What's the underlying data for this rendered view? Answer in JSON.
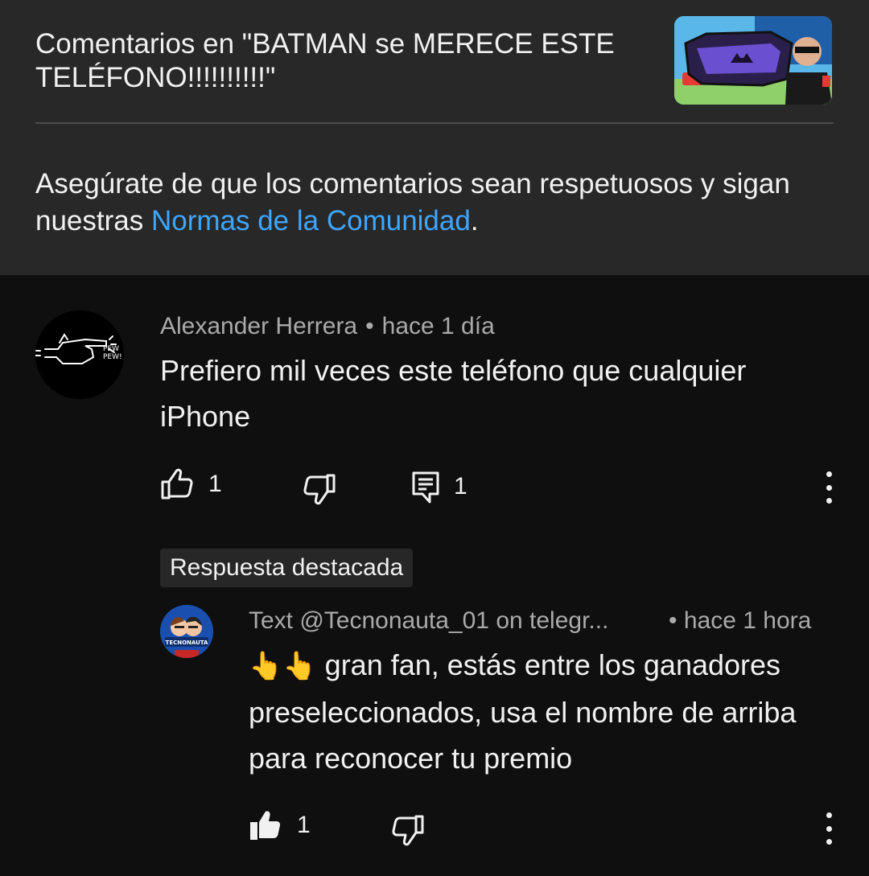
{
  "header": {
    "video_title": "Comentarios en \"BATMAN se MERECE ESTE TELÉFONO!!!!!!!!!!\"",
    "guidelines_text": "Asegúrate de que los comentarios sean respetuosos y sigan nuestras ",
    "guidelines_link": "Normas de la Comunidad",
    "guidelines_end": ".",
    "link_color": "#3ea6ff"
  },
  "comment": {
    "author": "Alexander Herrera",
    "separator": "•",
    "time": "hace 1 día",
    "text": "Prefiero mil veces este teléfono que cualquier iPhone",
    "likes": "1",
    "replies": "1"
  },
  "pinned_label": "Respuesta destacada",
  "reply": {
    "author": "Text  @Tecnonauta_01 on telegr...",
    "separator": "•",
    "time": "hace 1 hora",
    "emoji": "👆👆",
    "text": " gran fan, estás entre los ganadores preseleccionados, usa el nombre de arriba para reconocer tu premio",
    "likes": "1",
    "avatar_label": "TECNONAUTA"
  },
  "icons": {
    "like": "thumbs-up-icon",
    "dislike": "thumbs-down-icon",
    "reply": "comment-icon",
    "more": "more-vert-icon"
  }
}
